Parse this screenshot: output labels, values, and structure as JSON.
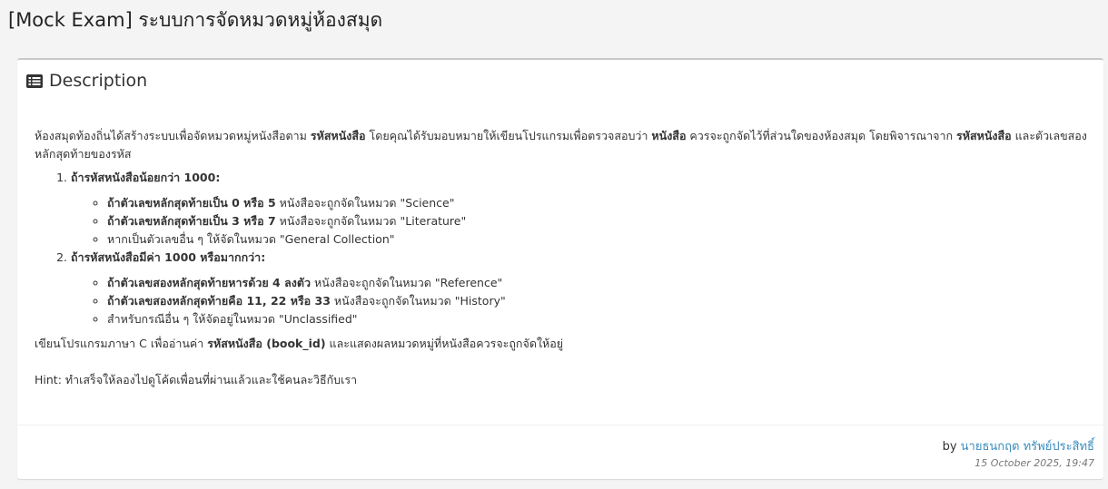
{
  "page": {
    "title": "[Mock Exam] ระบบการจัดหมวดหมู่ห้องสมุด"
  },
  "box": {
    "header_icon": "list-alt-icon",
    "header_title": "Description"
  },
  "description": {
    "intro": [
      "ห้องสมุดท้องถิ่นได้สร้างระบบเพื่อจัดหมวดหมู่หนังสือตาม ",
      "รหัสหนังสือ",
      " โดยคุณได้รับมอบหมายให้เขียนโปรแกรมเพื่อตรวจสอบว่า ",
      "หนังสือ",
      " ควรจะถูกจัดไว้ที่ส่วนใดของห้องสมุด โดยพิจารณาจาก ",
      "รหัสหนังสือ",
      " และตัวเลขสองหลักสุดท้ายของรหัส"
    ],
    "rules": [
      {
        "title": "ถ้ารหัสหนังสือน้อยกว่า 1000:",
        "items": [
          {
            "bold": "ถ้าตัวเลขหลักสุดท้ายเป็น 0 หรือ 5",
            "text": " หนังสือจะถูกจัดในหมวด \"Science\""
          },
          {
            "bold": "ถ้าตัวเลขหลักสุดท้ายเป็น 3 หรือ 7",
            "text": " หนังสือจะถูกจัดในหมวด \"Literature\""
          },
          {
            "bold": "",
            "text": "หากเป็นตัวเลขอื่น ๆ ให้จัดในหมวด \"General Collection\""
          }
        ]
      },
      {
        "title": "ถ้ารหัสหนังสือมีค่า 1000 หรือมากกว่า:",
        "items": [
          {
            "bold": "ถ้าตัวเลขสองหลักสุดท้ายหารด้วย 4 ลงตัว",
            "text": " หนังสือจะถูกจัดในหมวด \"Reference\""
          },
          {
            "bold": "ถ้าตัวเลขสองหลักสุดท้ายคือ 11, 22 หรือ 33",
            "text": " หนังสือจะถูกจัดในหมวด \"History\""
          },
          {
            "bold": "",
            "text": "สำหรับกรณีอื่น ๆ ให้จัดอยู่ในหมวด \"Unclassified\""
          }
        ]
      }
    ],
    "task": [
      "เขียนโปรแกรมภาษา C เพื่ออ่านค่า ",
      "รหัสหนังสือ (book_id)",
      " และแสดงผลหมวดหมู่ที่หนังสือควรจะถูกจัดให้อยู่"
    ],
    "hint": "Hint: ทำเสร็จให้ลองไปดูโค้ดเพื่อนที่ผ่านแล้วและใช้คนละวิธีกับเรา"
  },
  "footer": {
    "by_label": "by",
    "author": "นายธนกฤต ทรัพย์ประสิทธิ์",
    "timestamp": "15 October 2025, 19:47"
  },
  "colors": {
    "link": "#3c8dbc",
    "box_top_border": "#c8c8c8",
    "background": "#f4f4f4"
  }
}
